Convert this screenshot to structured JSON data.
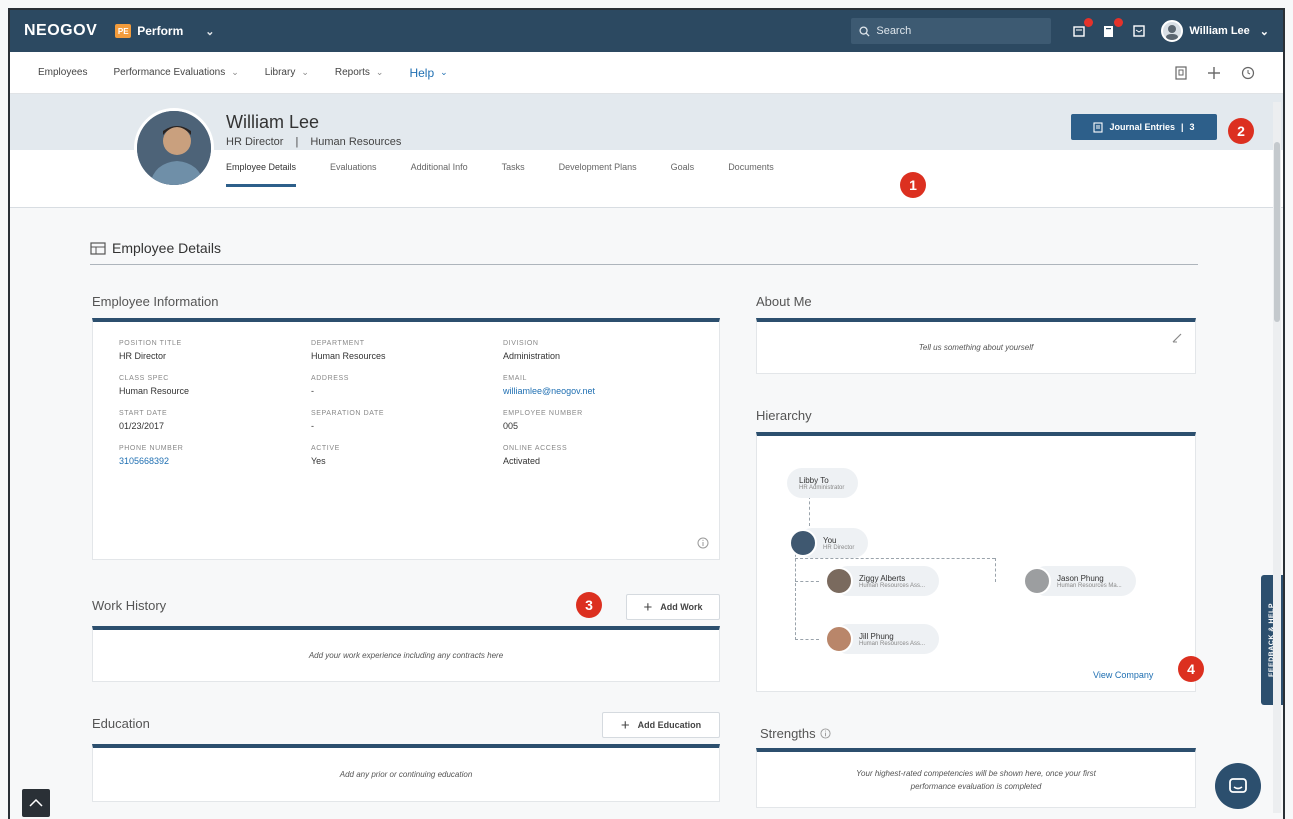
{
  "topbar": {
    "logo": "NEOGOV",
    "app_badge": "PE",
    "app_name": "Perform",
    "search_placeholder": "Search",
    "user_name": "William Lee"
  },
  "nav": {
    "items": [
      "Employees",
      "Performance Evaluations",
      "Library",
      "Reports"
    ],
    "help": "Help"
  },
  "profile": {
    "name": "William Lee",
    "title": "HR Director",
    "separator": "|",
    "department": "Human Resources",
    "journal_label": "Journal Entries",
    "journal_divider": "|",
    "journal_count": "3",
    "tabs": [
      "Employee Details",
      "Evaluations",
      "Additional Info",
      "Tasks",
      "Development Plans",
      "Goals",
      "Documents"
    ]
  },
  "badges": [
    "1",
    "2",
    "3",
    "4"
  ],
  "section_title": "Employee Details",
  "employee_info": {
    "title": "Employee Information",
    "fields": [
      {
        "label": "POSITION TITLE",
        "value": "HR Director"
      },
      {
        "label": "DEPARTMENT",
        "value": "Human Resources"
      },
      {
        "label": "DIVISION",
        "value": "Administration"
      },
      {
        "label": "CLASS SPEC",
        "value": "Human Resource"
      },
      {
        "label": "ADDRESS",
        "value": "-"
      },
      {
        "label": "EMAIL",
        "value": "williamlee@neogov.net"
      },
      {
        "label": "START DATE",
        "value": "01/23/2017"
      },
      {
        "label": "SEPARATION DATE",
        "value": "-"
      },
      {
        "label": "EMPLOYEE NUMBER",
        "value": "005"
      },
      {
        "label": "PHONE NUMBER",
        "value": "3105668392"
      },
      {
        "label": "ACTIVE",
        "value": "Yes"
      },
      {
        "label": "ONLINE ACCESS",
        "value": "Activated"
      }
    ]
  },
  "work_history": {
    "title": "Work History",
    "button": "Add Work",
    "empty": "Add your work experience including any contracts here"
  },
  "education": {
    "title": "Education",
    "button": "Add Education",
    "empty": "Add any prior or continuing education"
  },
  "about_me": {
    "title": "About Me",
    "empty": "Tell us something about yourself"
  },
  "hierarchy": {
    "title": "Hierarchy",
    "nodes": [
      {
        "name": "Libby To",
        "role": "HR Administrator"
      },
      {
        "name": "You",
        "role": "HR Director"
      },
      {
        "name": "Ziggy Alberts",
        "role": "Human Resources Ass..."
      },
      {
        "name": "Jason Phung",
        "role": "Human Resources Ma..."
      },
      {
        "name": "Jill Phung",
        "role": "Human Resources Ass..."
      }
    ],
    "view_company": "View Company"
  },
  "strengths": {
    "title": "Strengths",
    "empty_line1": "Your highest-rated competencies will be shown here, once your first",
    "empty_line2": "performance evaluation is completed"
  },
  "feedback_tab": "FEEDBACK & HELP",
  "colors": {
    "topbar": "#2c4961",
    "accent": "#2d5f8a",
    "badge": "#dc3020",
    "link": "#1f6fb2"
  }
}
